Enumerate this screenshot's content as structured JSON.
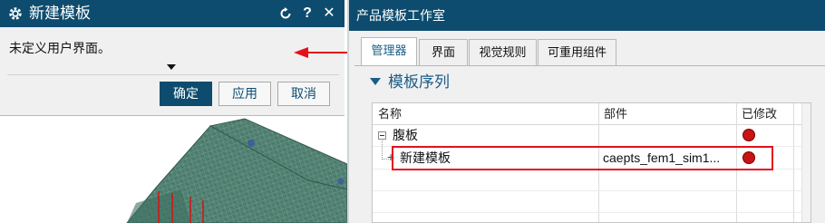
{
  "left_dialog": {
    "title": "新建模板",
    "icons": [
      "gear-icon",
      "reset-icon",
      "help-icon",
      "close-icon"
    ],
    "help_label": "?",
    "close_label": "✕",
    "message": "未定义用户界面。",
    "buttons": {
      "ok": "确定",
      "apply": "应用",
      "cancel": "取消"
    }
  },
  "right_panel": {
    "title": "产品模板工作室",
    "tabs": [
      "管理器",
      "界面",
      "视觉规则",
      "可重用组件"
    ],
    "active_tab": "管理器",
    "section_title": "模板序列",
    "table": {
      "columns": [
        "名称",
        "部件",
        "已修改"
      ],
      "rows": [
        {
          "name": "腹板",
          "part": "",
          "modified": true,
          "level": 0
        },
        {
          "name": "新建模板",
          "part": "caepts_fem1_sim1...",
          "modified": true,
          "level": 1
        }
      ]
    }
  },
  "colors": {
    "title_bar": "#0d4c6e",
    "accent": "#1a5d87",
    "modified_dot": "#c81414",
    "highlight": "#e3111c",
    "mesh": "#4f7f70"
  }
}
